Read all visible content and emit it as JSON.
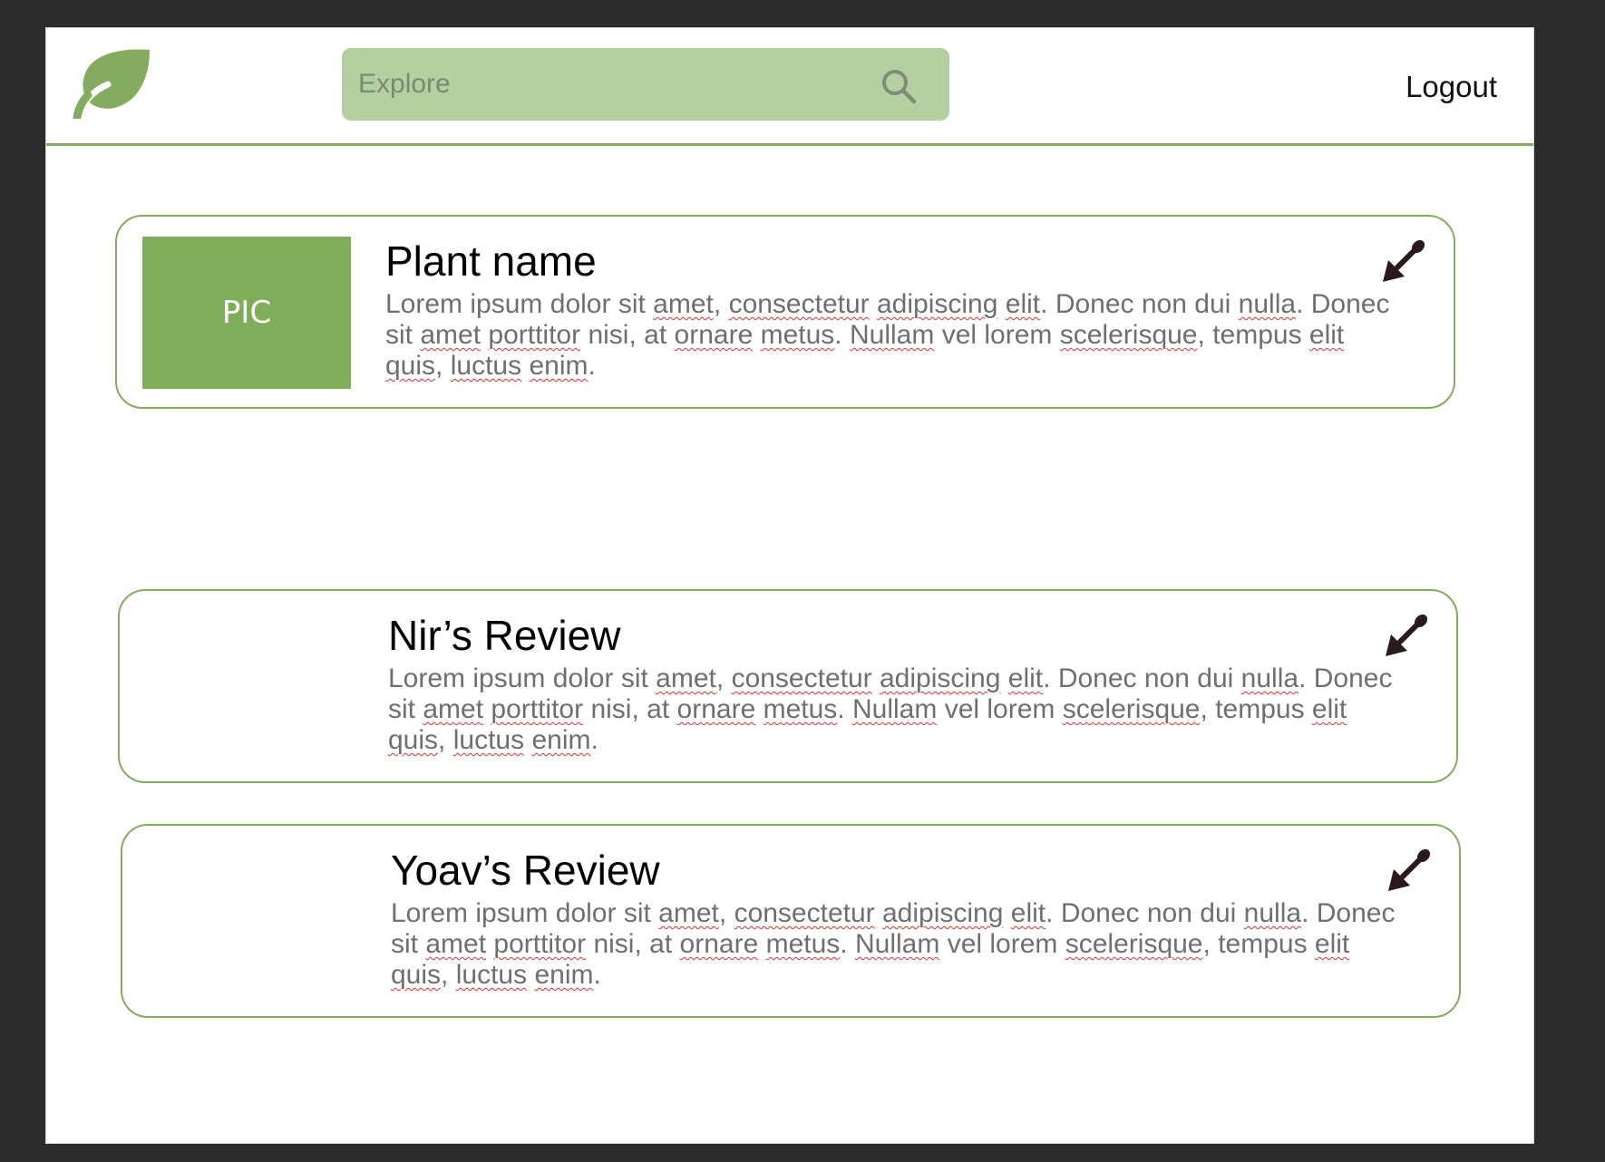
{
  "header": {
    "search_placeholder": "Explore",
    "logout_label": "Logout",
    "logo_icon": "leaf-icon",
    "search_icon": "search-icon"
  },
  "colors": {
    "accent": "#84ab60",
    "search_bg": "#b4d0a0",
    "pic_bg": "#80ad59"
  },
  "cards": [
    {
      "pic_label": "PIC",
      "title": "Plant name",
      "body": "Lorem ipsum dolor sit amet, consectetur adipiscing elit. Donec non dui nulla. Donec sit amet porttitor nisi, at ornare metus. Nullam vel lorem scelerisque, tempus elit quis, luctus enim.",
      "icon": "trowel-icon"
    },
    {
      "title": "Nir’s Review",
      "body": "Lorem ipsum dolor sit amet, consectetur adipiscing elit. Donec non dui nulla. Donec sit amet porttitor nisi, at ornare metus. Nullam vel lorem scelerisque, tempus elit quis, luctus enim.",
      "icon": "trowel-icon"
    },
    {
      "title": "Yoav’s Review",
      "body": "Lorem ipsum dolor sit amet, consectetur adipiscing elit. Donec non dui nulla. Donec sit amet porttitor nisi, at ornare metus. Nullam vel lorem scelerisque, tempus elit quis, luctus enim.",
      "icon": "trowel-icon"
    }
  ]
}
